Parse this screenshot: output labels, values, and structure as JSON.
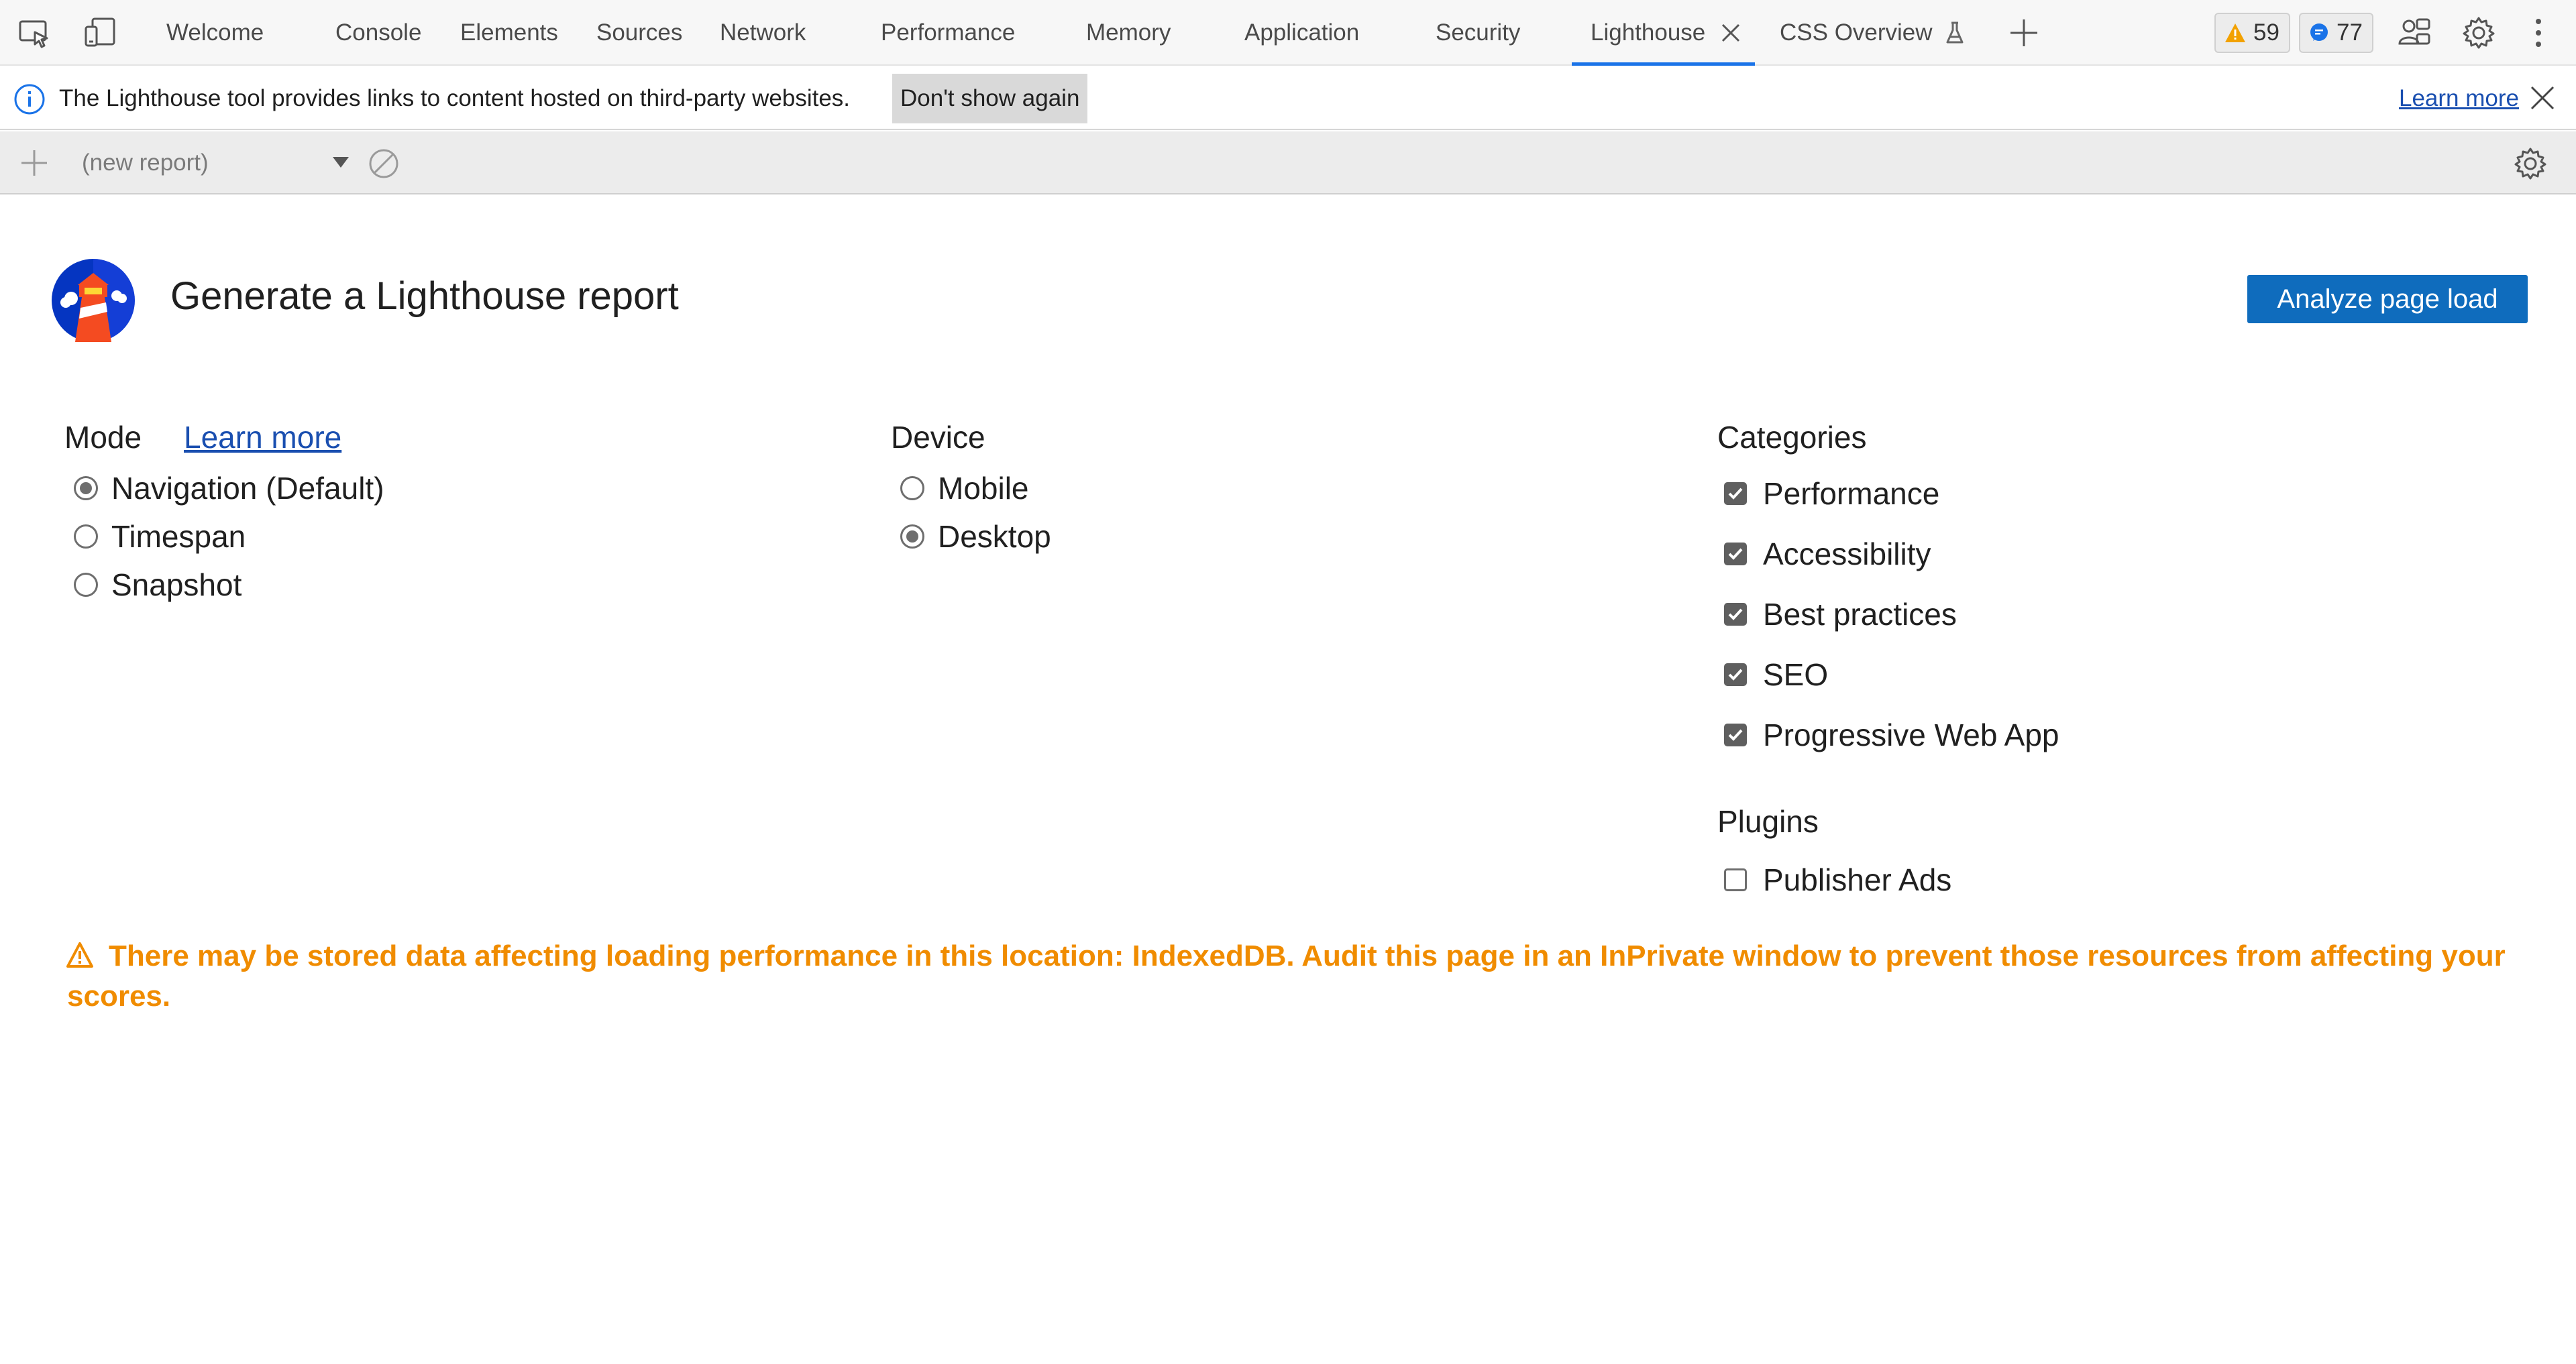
{
  "toolbar": {
    "tabs": [
      {
        "label": "Welcome"
      },
      {
        "label": "Console"
      },
      {
        "label": "Elements"
      },
      {
        "label": "Sources"
      },
      {
        "label": "Network"
      },
      {
        "label": "Performance"
      },
      {
        "label": "Memory"
      },
      {
        "label": "Application"
      },
      {
        "label": "Security"
      },
      {
        "label": "Lighthouse",
        "active": true
      },
      {
        "label": "CSS Overview"
      }
    ],
    "warnings_count": "59",
    "messages_count": "77",
    "icons": [
      "inspect-element-icon",
      "device-emulation-icon",
      "close-icon",
      "experiment-flask-icon",
      "add-tab-icon",
      "warning-icon",
      "message-icon",
      "feedback-icon",
      "settings-icon",
      "more-options-icon"
    ]
  },
  "infobar": {
    "message": "The Lighthouse tool provides links to content hosted on third-party websites.",
    "dont_show_label": "Don't show again",
    "learn_more": "Learn more"
  },
  "reportbar": {
    "selected_report": "(new report)"
  },
  "panel": {
    "title": "Generate a Lighthouse report",
    "analyze_button": "Analyze page load",
    "mode": {
      "heading": "Mode",
      "learn_more": "Learn more",
      "options": [
        {
          "label": "Navigation (Default)",
          "checked": true
        },
        {
          "label": "Timespan",
          "checked": false
        },
        {
          "label": "Snapshot",
          "checked": false
        }
      ]
    },
    "device": {
      "heading": "Device",
      "options": [
        {
          "label": "Mobile",
          "checked": false
        },
        {
          "label": "Desktop",
          "checked": true
        }
      ]
    },
    "categories": {
      "heading": "Categories",
      "items": [
        {
          "label": "Performance",
          "checked": true
        },
        {
          "label": "Accessibility",
          "checked": true
        },
        {
          "label": "Best practices",
          "checked": true
        },
        {
          "label": "SEO",
          "checked": true
        },
        {
          "label": "Progressive Web App",
          "checked": true
        }
      ]
    },
    "plugins": {
      "heading": "Plugins",
      "items": [
        {
          "label": "Publisher Ads",
          "checked": false
        }
      ]
    },
    "warning": "There may be stored data affecting loading performance in this location: IndexedDB. Audit this page in an InPrivate window to prevent those resources from affecting your scores."
  },
  "colors": {
    "accent": "#0f6cbd",
    "active_tab_underline": "#1a73e8",
    "warning_text": "#f08c00",
    "link": "#1a4fb0"
  }
}
